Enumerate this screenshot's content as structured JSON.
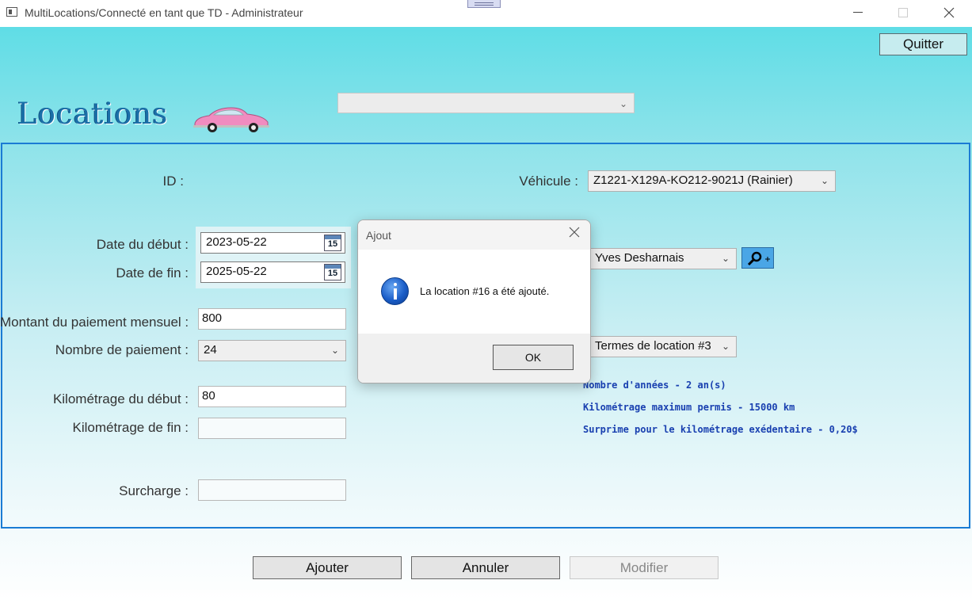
{
  "window": {
    "title": "MultiLocations/Connecté en tant que TD - Administrateur"
  },
  "header": {
    "quit_label": "Quitter",
    "page_heading": "Locations",
    "top_combo_value": ""
  },
  "form": {
    "id_label": "ID :",
    "id_value": "",
    "start_date_label": "Date du début :",
    "start_date_value": "2023-05-22",
    "end_date_label": "Date de fin :",
    "end_date_value": "2025-05-22",
    "calendar_day": "15",
    "monthly_payment_label": "Montant du paiement mensuel :",
    "monthly_payment_value": "800",
    "payment_count_label": "Nombre de paiement :",
    "payment_count_value": "24",
    "km_start_label": "Kilométrage du début :",
    "km_start_value": "80",
    "km_end_label": "Kilométrage de fin :",
    "km_end_value": "",
    "surcharge_label": "Surcharge :",
    "surcharge_value": "",
    "vehicle_label": "Véhicule :",
    "vehicle_value": "Z1221-X129A-KO212-9021J  (Rainier)",
    "client_value": "Yves Desharnais",
    "terms_value": "Termes de location #3",
    "terms_details": [
      "Nombre d'années - 2 an(s)",
      "Kilométrage maximum permis - 15000 km",
      "Surprime pour le kilométrage exédentaire - 0,20$"
    ]
  },
  "actions": {
    "add_label": "Ajouter",
    "cancel_label": "Annuler",
    "modify_label": "Modifier"
  },
  "dialog": {
    "title": "Ajout",
    "message": "La location #16 a été ajouté.",
    "ok_label": "OK"
  },
  "icons": {
    "app": "app-window-icon",
    "car": "pink-car-icon",
    "calendar": "calendar-icon",
    "search_add": "search-add-icon",
    "info": "information-icon"
  },
  "colors": {
    "accent_border": "#1b7bd4",
    "heading": "#1a6fa8",
    "terms_text": "#1940b0"
  }
}
